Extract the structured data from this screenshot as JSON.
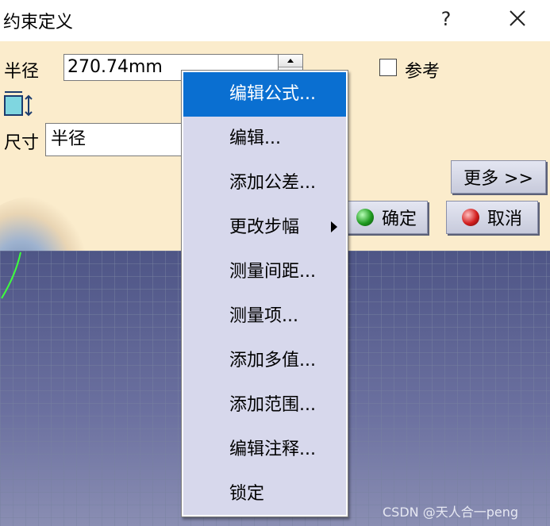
{
  "window": {
    "title": "约束定义",
    "help_label": "?",
    "close_icon": "close-icon"
  },
  "form": {
    "radius_label": "半径",
    "radius_value": "270.74mm",
    "reference_label": "参考",
    "reference_checked": false,
    "dimension_label": "尺寸",
    "dimension_value": "半径",
    "dimension_icon": "dimension-icon"
  },
  "buttons": {
    "more": "更多 >>",
    "ok": "确定",
    "cancel": "取消",
    "ok_color": "#1f9a1f",
    "cancel_color": "#d21e1e"
  },
  "context_menu": {
    "highlight_color": "#0a6fd1",
    "items": [
      {
        "label": "编辑公式..."
      },
      {
        "label": "编辑..."
      },
      {
        "label": "添加公差..."
      },
      {
        "label": "更改步幅",
        "has_submenu": true
      },
      {
        "label": "测量间距..."
      },
      {
        "label": "测量项..."
      },
      {
        "label": "添加多值..."
      },
      {
        "label": "添加范围..."
      },
      {
        "label": "编辑注释..."
      },
      {
        "label": "锁定"
      }
    ]
  },
  "watermark": "CSDN @天人合一peng"
}
